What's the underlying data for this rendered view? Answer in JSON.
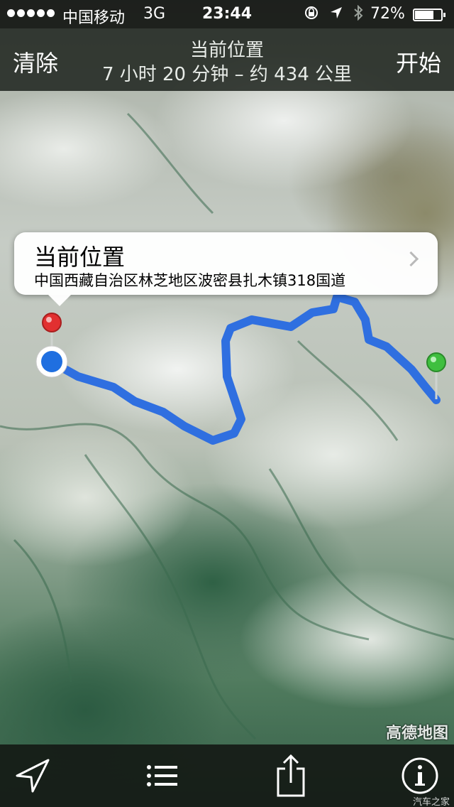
{
  "status_bar": {
    "carrier": "中国移动",
    "network": "3G",
    "time": "23:44",
    "battery_percent": "72%",
    "battery_level": 0.72
  },
  "nav": {
    "left_button": "清除",
    "title": "当前位置",
    "subtitle": "7 小时 20 分钟 – 约 434 公里",
    "right_button": "开始"
  },
  "callout": {
    "title": "当前位置",
    "address": "中国西藏自治区林芝地区波密县扎木镇318国道"
  },
  "map": {
    "watermark": "高德地图",
    "route_color": "#2f6fe0",
    "start_pin_color": "#e23030",
    "end_pin_color": "#3fbf3f",
    "current_location_color": "#1f6fe0"
  },
  "toolbar": {
    "icons": [
      "location-arrow-icon",
      "list-icon",
      "share-icon",
      "info-icon"
    ]
  },
  "credit": "汽车之家"
}
